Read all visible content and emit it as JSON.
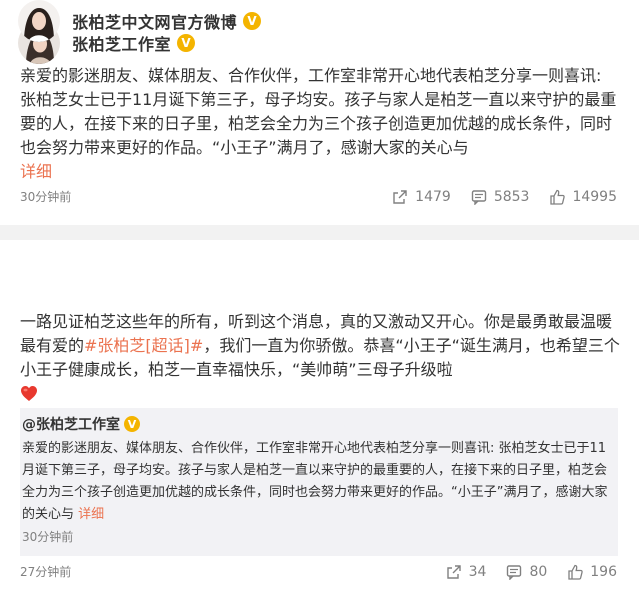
{
  "post1": {
    "author": "张柏芝工作室",
    "text": "亲爱的影迷朋友、媒体朋友、合作伙伴，工作室非常开心地代表柏芝分享一则喜讯: 张柏芝女士已于11月诞下第三子，母子均安。孩子与家人是柏芝一直以来守护的最重要的人，在接下来的日子里，柏芝会全力为三个孩子创造更加优越的成长条件，同时也会努力带来更好的作品。“小王子”满月了，感谢大家的关心与",
    "more": "详细",
    "time": "30分钟前",
    "reposts": "1479",
    "comments": "5853",
    "likes": "14995"
  },
  "post2": {
    "author": "张柏芝中文网官方微博",
    "text_a": "一路见证柏芝这些年的所有，听到这个消息，真的又激动又开心。你是最勇敢最温暖最有爱的",
    "topic": "#张柏芝[超话]#",
    "text_b": "，我们一直为你骄傲。恭喜“小王子“诞生满月，也希望三个小王子健康成长，柏芝一直幸福快乐，“美帅萌”三母子升级啦",
    "time": "27分钟前",
    "reposts": "34",
    "comments": "80",
    "likes": "196",
    "retweet": {
      "author": "@张柏芝工作室",
      "text": "亲爱的影迷朋友、媒体朋友、合作伙伴，工作室非常开心地代表柏芝分享一则喜讯: 张柏芝女士已于11月诞下第三子，母子均安。孩子与家人是柏芝一直以来守护的最重要的人，在接下来的日子里，柏芝会全力为三个孩子创造更加优越的成长条件，同时也会努力带来更好的作品。“小王子”满月了，感谢大家的关心与",
      "more": "详细",
      "time": "30分钟前"
    }
  },
  "icons": {
    "verified": "V",
    "repost": "repost-icon",
    "comment": "comment-icon",
    "like": "like-icon",
    "heart": "heart-emoji"
  },
  "colors": {
    "accent": "#eb7350",
    "badge": "#f4b400",
    "muted": "#808080",
    "retweet_bg": "#f2f2f5"
  }
}
